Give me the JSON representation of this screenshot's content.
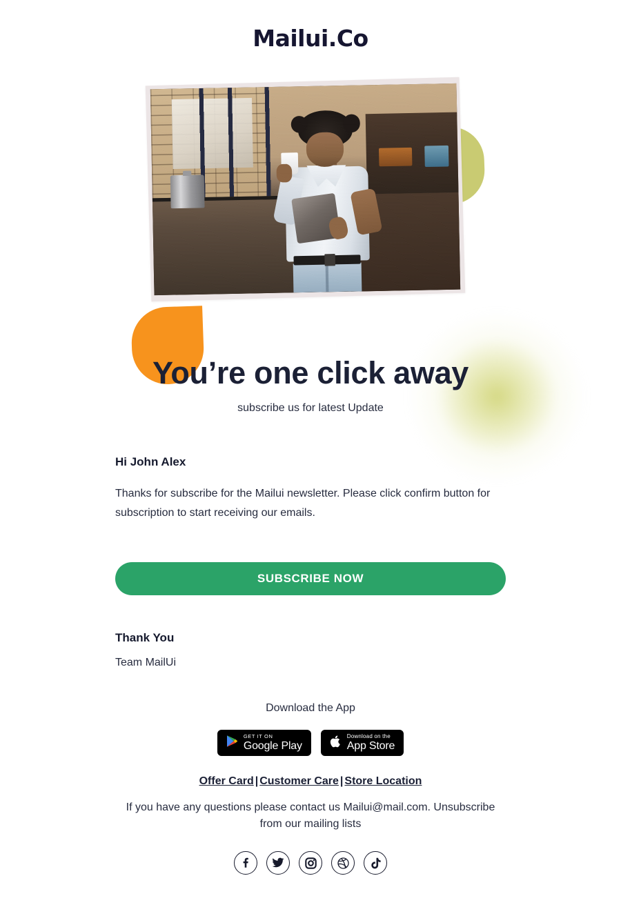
{
  "brand": {
    "logo": "Mailui.Co"
  },
  "hero": {
    "image_alt": "man-with-tablet-and-coffee-in-cafe",
    "shape_olive_color": "#c9cb72",
    "shape_orange_color": "#f7931d",
    "frame_color": "#ece5e6"
  },
  "headline": {
    "title": "You’re one click away",
    "subtitle": "subscribe us for latest Update"
  },
  "message": {
    "greeting": "Hi John Alex",
    "body": "Thanks for subscribe for the Mailui newsletter. Please click confirm button for subscription to start receiving our emails.",
    "cta_label": "SUBSCRIBE NOW",
    "cta_color": "#2ba368",
    "signoff": "Thank You",
    "team": "Team MailUi"
  },
  "footer": {
    "download_label": "Download the App",
    "badges": [
      {
        "name": "google-play",
        "small": "GET IT ON",
        "big": "Google Play"
      },
      {
        "name": "app-store",
        "small": "Download on the",
        "big": "App Store"
      }
    ],
    "links": [
      {
        "label": "Offer Card"
      },
      {
        "label": "Customer Care"
      },
      {
        "label": "Store Location"
      }
    ],
    "link_separator": "|",
    "legal": "If you have any questions please contact us Mailui@mail.com. Unsubscribe from our mailing lists",
    "socials": [
      {
        "name": "facebook-icon"
      },
      {
        "name": "twitter-icon"
      },
      {
        "name": "instagram-icon"
      },
      {
        "name": "dribbble-icon"
      },
      {
        "name": "tiktok-icon"
      }
    ]
  }
}
